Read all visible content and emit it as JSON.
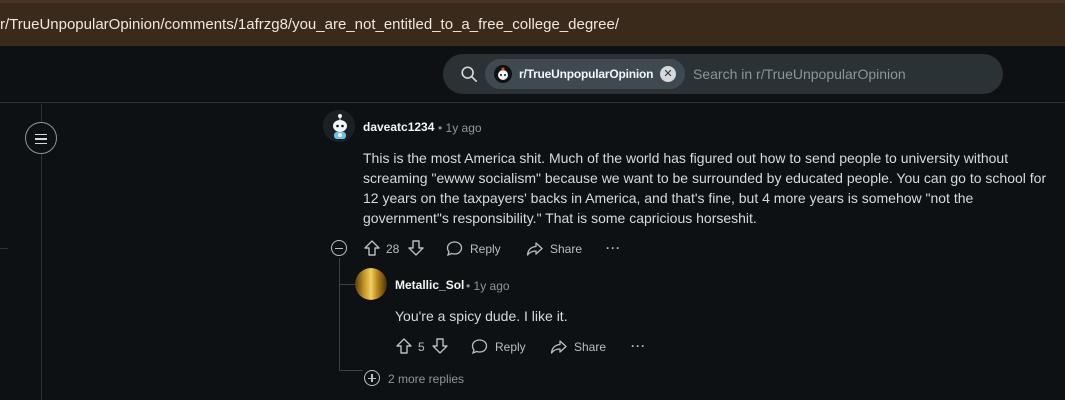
{
  "browser": {
    "url": "r/TrueUnpopularOpinion/comments/1afrzg8/you_are_not_entitled_to_a_free_college_degree/"
  },
  "search": {
    "community_chip": "r/TrueUnpopularOpinion",
    "placeholder": "Search in r/TrueUnpopularOpinion"
  },
  "comments": [
    {
      "author": "daveatc1234",
      "time": "1y ago",
      "body": "This is the most America shit. Much of the world has figured out how to send people to university without screaming \"ewww socialism\" because we want to be surrounded by educated people. You can go to school for 12 years on the taxpayers' backs in America, and that's fine, but 4 more years is somehow \"not the government\"s responsibility.\" That is some capricious horseshit.",
      "score": "28",
      "reply_label": "Reply",
      "share_label": "Share",
      "more_label": "···"
    },
    {
      "author": "Metallic_Sol",
      "time": "1y ago",
      "body": "You're a spicy dude. I like it.",
      "score": "5",
      "reply_label": "Reply",
      "share_label": "Share",
      "more_label": "···"
    }
  ],
  "more_replies": "2 more replies",
  "separator": "•"
}
